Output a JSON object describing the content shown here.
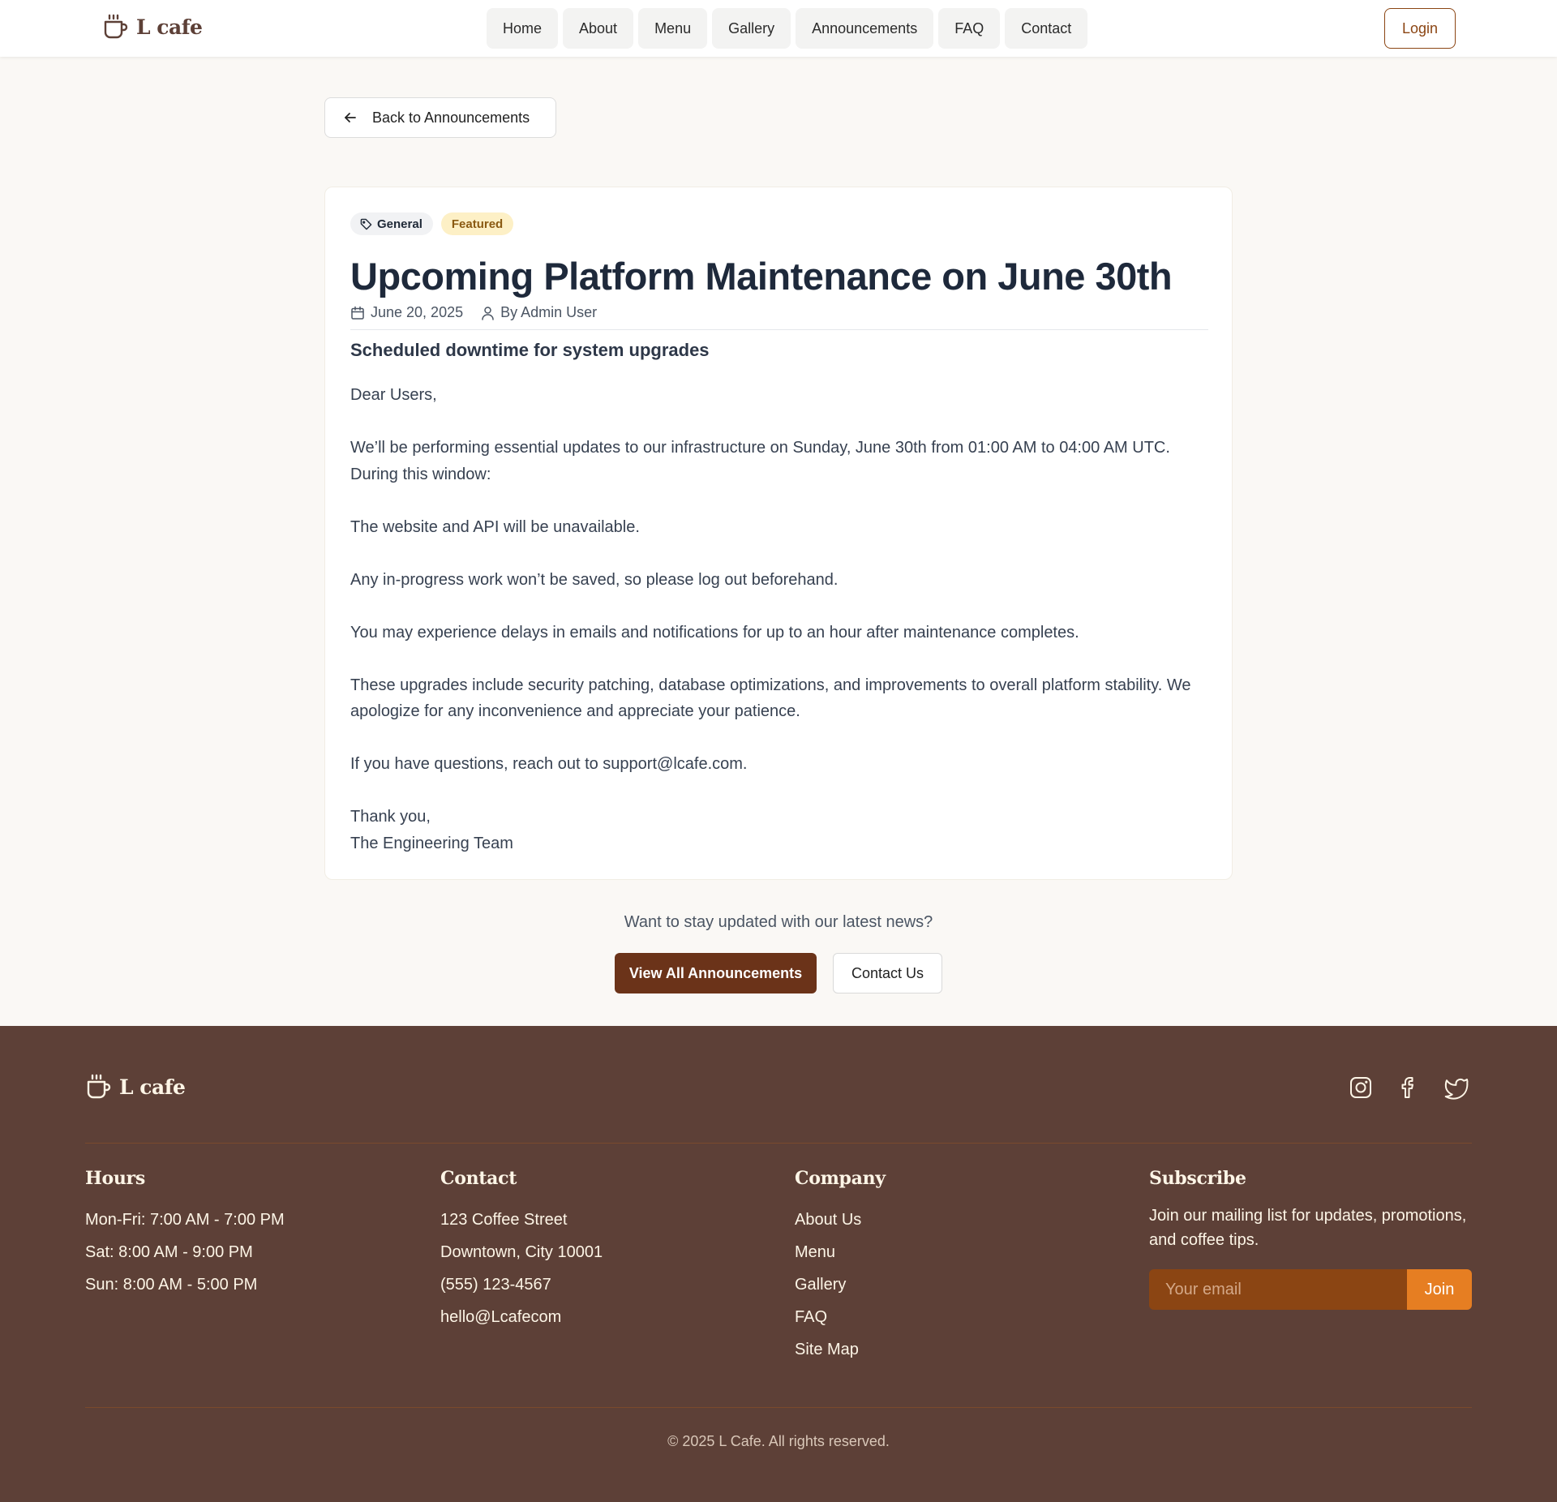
{
  "header": {
    "brand": "L cafe",
    "nav": [
      "Home",
      "About",
      "Menu",
      "Gallery",
      "Announcements",
      "FAQ",
      "Contact"
    ],
    "login_label": "Login"
  },
  "back_label": "Back to Announcements",
  "article": {
    "tags": {
      "category": "General",
      "featured": "Featured"
    },
    "title": "Upcoming Platform Maintenance on June 30th",
    "date": "June 20, 2025",
    "author": "By Admin User",
    "subtitle": "Scheduled downtime for system upgrades",
    "paragraphs": [
      "Dear Users,",
      "We’ll be performing essential updates to our infrastructure on Sunday, June 30th from 01:00 AM to 04:00 AM UTC. During this window:",
      "The website and API will be unavailable.",
      "Any in-progress work won’t be saved, so please log out beforehand.",
      "You may experience delays in emails and notifications for up to an hour after maintenance completes.",
      "These upgrades include security patching, database optimizations, and improvements to overall platform stability. We apologize for any inconvenience and appreciate your patience.",
      "If you have questions, reach out to support@lcafe.com."
    ],
    "signoff_1": "Thank you,",
    "signoff_2": "The Engineering Team"
  },
  "cta": {
    "text": "Want to stay updated with our latest news?",
    "primary": "View All Announcements",
    "secondary": "Contact Us"
  },
  "footer": {
    "brand": "L cafe",
    "socials": [
      "instagram-icon",
      "facebook-icon",
      "twitter-icon"
    ],
    "hours": {
      "heading": "Hours",
      "lines": [
        "Mon-Fri: 7:00 AM - 7:00 PM",
        "Sat: 8:00 AM - 9:00 PM",
        "Sun: 8:00 AM - 5:00 PM"
      ]
    },
    "contact": {
      "heading": "Contact",
      "lines": [
        "123 Coffee Street",
        "Downtown, City 10001",
        "(555) 123-4567",
        "hello@Lcafecom"
      ]
    },
    "company": {
      "heading": "Company",
      "links": [
        "About Us",
        "Menu",
        "Gallery",
        "FAQ",
        "Site Map"
      ]
    },
    "subscribe": {
      "heading": "Subscribe",
      "text": "Join our mailing list for updates, promotions, and coffee tips.",
      "placeholder": "Your email",
      "button": "Join"
    },
    "copyright": "© 2025 L Cafe. All rights reserved."
  },
  "colors": {
    "brand": "#5d4037",
    "accent": "#8b4513",
    "primary_button": "#6b3319",
    "join_button": "#e67e22",
    "page_background": "#faf8f5"
  }
}
